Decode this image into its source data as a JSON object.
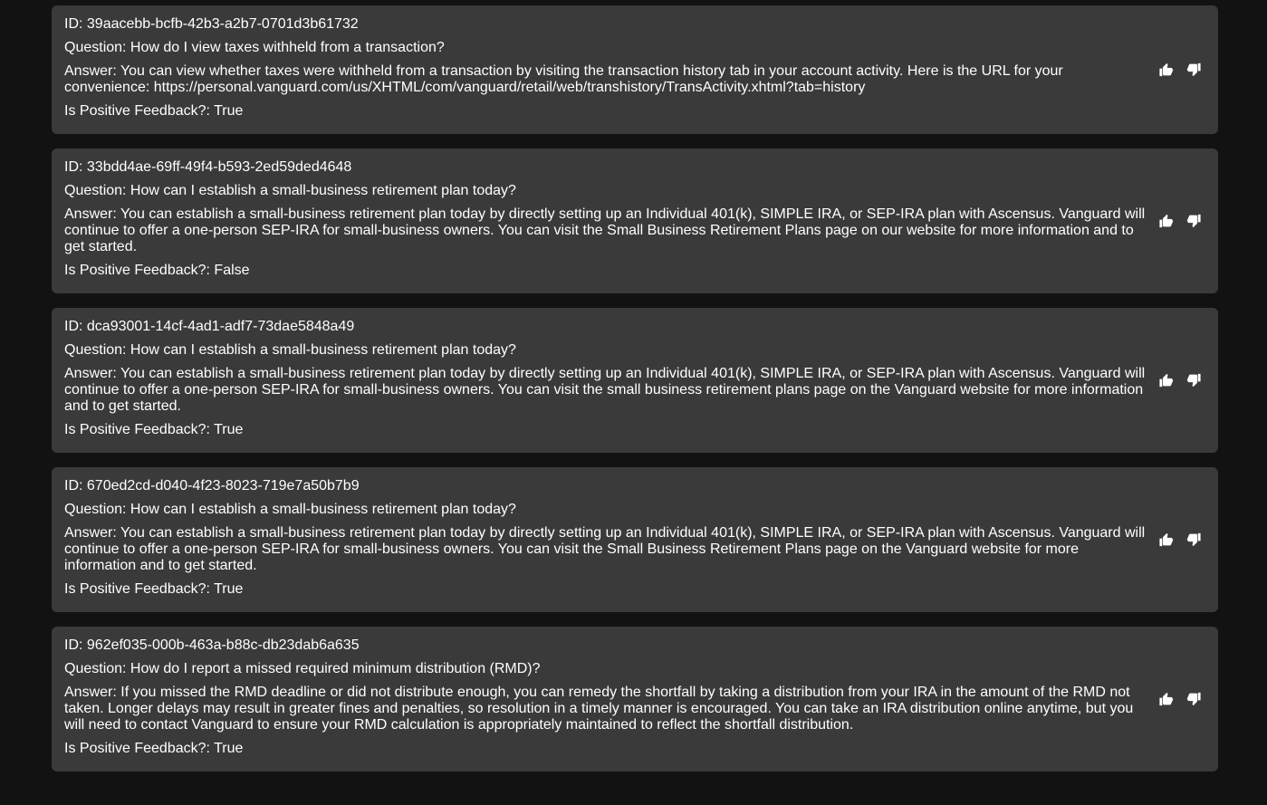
{
  "labels": {
    "id_prefix": "ID: ",
    "question_prefix": "Question: ",
    "answer_prefix": "Answer: ",
    "feedback_prefix": "Is Positive Feedback?: "
  },
  "entries": [
    {
      "id": "ID: 39aacebb-bcfb-42b3-a2b7-0701d3b61732",
      "question": "Question: How do I view taxes withheld from a transaction?",
      "answer": "Answer: You can view whether taxes were withheld from a transaction by visiting the transaction history tab in your account activity. Here is the URL for your convenience: https://personal.vanguard.com/us/XHTML/com/vanguard/retail/web/transhistory/TransActivity.xhtml?tab=history",
      "feedback": "Is Positive Feedback?: True"
    },
    {
      "id": "ID: 33bdd4ae-69ff-49f4-b593-2ed59ded4648",
      "question": "Question: How can I establish a small-business retirement plan today?",
      "answer": "Answer: You can establish a small-business retirement plan today by directly setting up an Individual 401(k), SIMPLE IRA, or SEP-IRA plan with Ascensus. Vanguard will continue to offer a one-person SEP-IRA for small-business owners. You can visit the Small Business Retirement Plans page on our website for more information and to get started.",
      "feedback": "Is Positive Feedback?: False"
    },
    {
      "id": "ID: dca93001-14cf-4ad1-adf7-73dae5848a49",
      "question": "Question: How can I establish a small-business retirement plan today?",
      "answer": "Answer: You can establish a small-business retirement plan today by directly setting up an Individual 401(k), SIMPLE IRA, or SEP-IRA plan with Ascensus. Vanguard will continue to offer a one-person SEP-IRA for small-business owners. You can visit the small business retirement plans page on the Vanguard website for more information and to get started.",
      "feedback": "Is Positive Feedback?: True"
    },
    {
      "id": "ID: 670ed2cd-d040-4f23-8023-719e7a50b7b9",
      "question": "Question: How can I establish a small-business retirement plan today?",
      "answer": "Answer: You can establish a small-business retirement plan today by directly setting up an Individual 401(k), SIMPLE IRA, or SEP-IRA plan with Ascensus. Vanguard will continue to offer a one-person SEP-IRA for small-business owners. You can visit the Small Business Retirement Plans page on the Vanguard website for more information and to get started.",
      "feedback": "Is Positive Feedback?: True"
    },
    {
      "id": "ID: 962ef035-000b-463a-b88c-db23dab6a635",
      "question": "Question: How do I report a missed required minimum distribution (RMD)?",
      "answer": "Answer: If you missed the RMD deadline or did not distribute enough, you can remedy the shortfall by taking a distribution from your IRA in the amount of the RMD not taken. Longer delays may result in greater fines and penalties, so resolution in a timely manner is encouraged. You can take an IRA distribution online anytime, but you will need to contact Vanguard to ensure your RMD calculation is appropriately maintained to reflect the shortfall distribution.",
      "feedback": "Is Positive Feedback?: True"
    }
  ],
  "icons": {
    "thumbs_up": "thumbs-up-icon",
    "thumbs_down": "thumbs-down-icon"
  },
  "colors": {
    "background": "#121212",
    "card": "#3a3a3a",
    "text": "#ffffff"
  }
}
